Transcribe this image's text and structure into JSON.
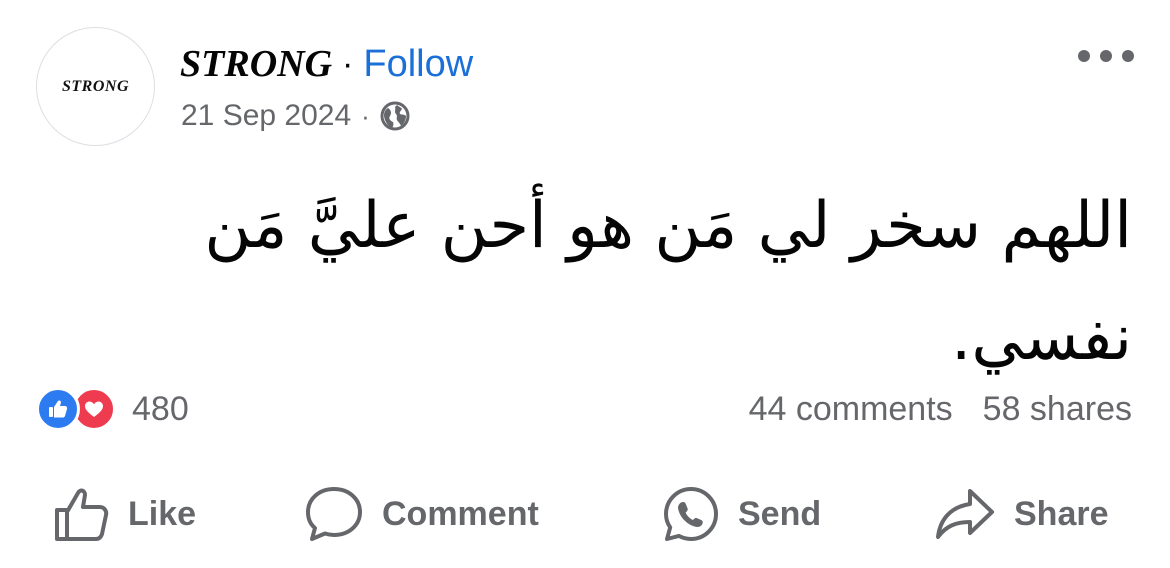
{
  "avatar": {
    "text": "STRONG"
  },
  "header": {
    "page_name": "STRONG",
    "separator": "·",
    "follow_label": "Follow",
    "more_icon": "more-options-icon"
  },
  "meta": {
    "date": "21 Sep 2024",
    "separator": "·",
    "audience_icon": "globe-icon"
  },
  "post": {
    "text": "اللهم سخر لي مَن هو أحن عليَّ مَن نفسي."
  },
  "reactions": {
    "icons": [
      "like-reaction-icon",
      "love-reaction-icon"
    ],
    "count": "480",
    "comments": "44 comments",
    "shares": "58 shares"
  },
  "actions": {
    "like_label": "Like",
    "comment_label": "Comment",
    "send_label": "Send",
    "share_label": "Share"
  },
  "colors": {
    "accent": "#1b6fd8",
    "muted": "#65676b",
    "like": "#2d7bf0",
    "love": "#ef3b4f"
  }
}
